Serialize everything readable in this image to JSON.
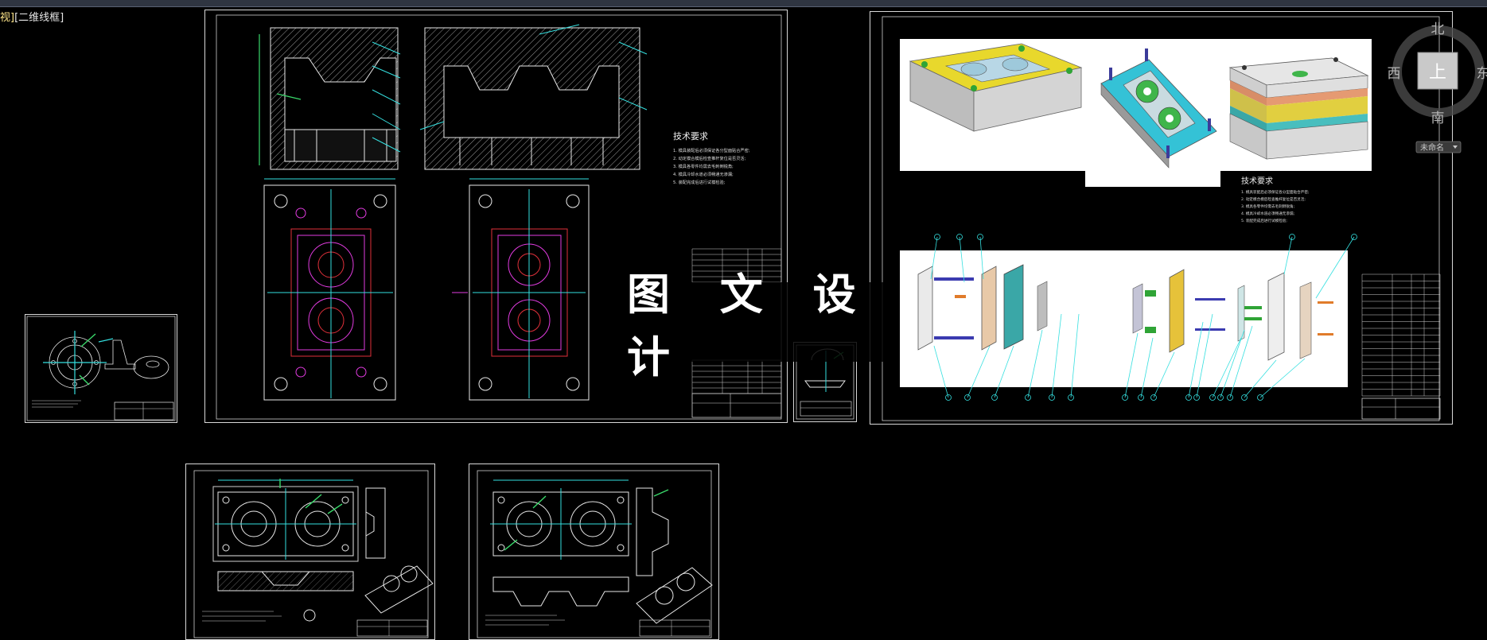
{
  "viewport": {
    "prefix": "视]",
    "mode": "[二维线框]"
  },
  "viewcube": {
    "north": "北",
    "south": "南",
    "west": "西",
    "east": "东",
    "top_face": "上",
    "wcs_label": "未命名"
  },
  "watermark": {
    "text": "图 文 设 计"
  },
  "sheets": {
    "main_assembly": {
      "tech_title": "技术要求",
      "tech_lines": [
        "1. 模具装配后必须保证各分型面贴合严密;",
        "2. 动定模合模后检查推杆复位是否灵活;",
        "3. 模具各零件均需去毛刺倒锐角;",
        "4. 模具冷却水道必须畅通无渗漏;",
        "5. 装配完成后进行试模检验;"
      ]
    },
    "exploded_3d": {
      "tech_title": "技术要求",
      "tech_lines": [
        "1. 模具装配后必须保证各分型面贴合严密;",
        "2. 动定模合模后检查推杆复位是否灵活;",
        "3. 模具各零件均需去毛刺倒锐角;",
        "4. 模具冷却水道必须畅通无渗漏;",
        "5. 装配完成后进行试模检验;"
      ]
    }
  },
  "colors": {
    "background": "#000000",
    "border": "#d8d8d8",
    "cad_white": "#e8e8e8",
    "cad_cyan": "#35e0e0",
    "cad_red": "#e0303a",
    "cad_magenta": "#e23be0",
    "cad_green": "#39d86a",
    "cad_yellow": "#ffe000"
  }
}
